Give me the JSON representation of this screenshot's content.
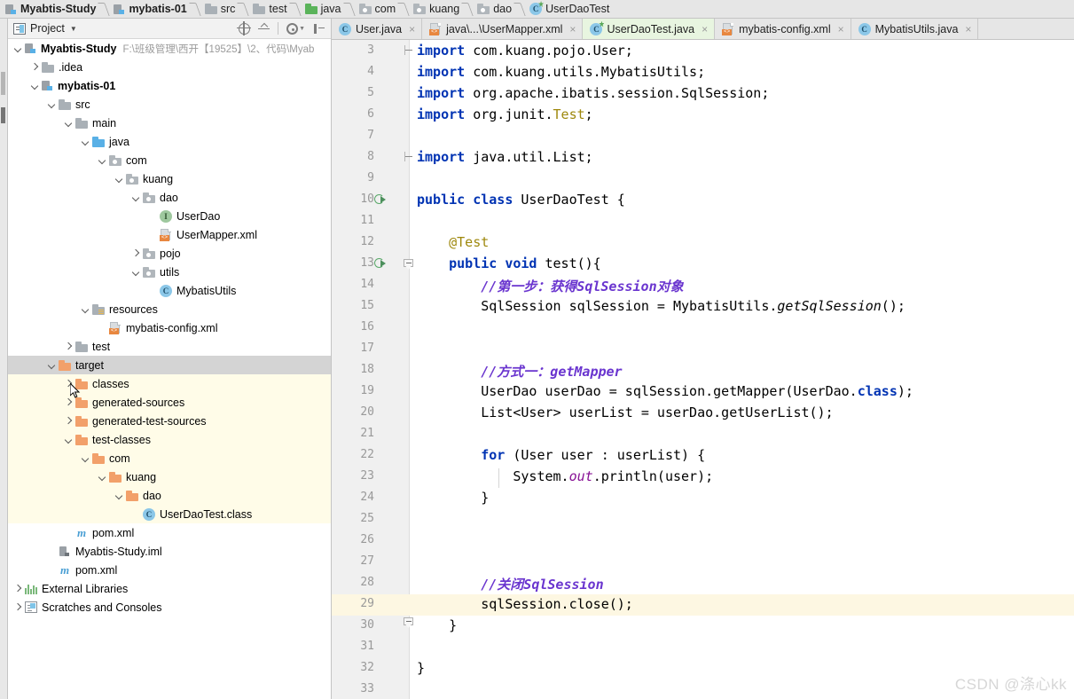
{
  "navbar": {
    "crumbs": [
      {
        "label": "Myabtis-Study",
        "icon": "module-icon",
        "bold": true
      },
      {
        "label": "mybatis-01",
        "icon": "module-icon",
        "bold": true
      },
      {
        "label": "src",
        "icon": "folder-gray-icon",
        "bold": false
      },
      {
        "label": "test",
        "icon": "folder-gray-icon",
        "bold": false
      },
      {
        "label": "java",
        "icon": "folder-green-icon",
        "bold": false
      },
      {
        "label": "com",
        "icon": "package-icon",
        "bold": false
      },
      {
        "label": "kuang",
        "icon": "package-icon",
        "bold": false
      },
      {
        "label": "dao",
        "icon": "package-icon",
        "bold": false
      },
      {
        "label": "UserDaoTest",
        "icon": "java-test-class-icon",
        "bold": false
      }
    ]
  },
  "project_panel": {
    "title": "Project",
    "toolbar_icons": [
      "locate-icon",
      "collapse-all-icon",
      "settings-gear-icon",
      "hide-panel-icon"
    ],
    "tree": [
      {
        "label": "Myabtis-Study",
        "path": "F:\\班级管理\\西开【19525】\\2、代码\\Myab",
        "icon": "module-icon",
        "arrow": "down",
        "depth": 0,
        "bold": true,
        "selected": false,
        "tinted": false
      },
      {
        "label": ".idea",
        "icon": "folder-gray-icon",
        "arrow": "right",
        "depth": 1,
        "bold": false,
        "selected": false,
        "tinted": false
      },
      {
        "label": "mybatis-01",
        "icon": "module-icon",
        "arrow": "down",
        "depth": 1,
        "bold": true,
        "selected": false,
        "tinted": false
      },
      {
        "label": "src",
        "icon": "folder-gray-icon",
        "arrow": "down",
        "depth": 2,
        "bold": false,
        "selected": false,
        "tinted": false
      },
      {
        "label": "main",
        "icon": "folder-gray-icon",
        "arrow": "down",
        "depth": 3,
        "bold": false,
        "selected": false,
        "tinted": false
      },
      {
        "label": "java",
        "icon": "folder-blue-icon",
        "arrow": "down",
        "depth": 4,
        "bold": false,
        "selected": false,
        "tinted": false
      },
      {
        "label": "com",
        "icon": "package-icon",
        "arrow": "down",
        "depth": 5,
        "bold": false,
        "selected": false,
        "tinted": false
      },
      {
        "label": "kuang",
        "icon": "package-icon",
        "arrow": "down",
        "depth": 6,
        "bold": false,
        "selected": false,
        "tinted": false
      },
      {
        "label": "dao",
        "icon": "package-icon",
        "arrow": "down",
        "depth": 7,
        "bold": false,
        "selected": false,
        "tinted": false
      },
      {
        "label": "UserDao",
        "icon": "java-interface-icon",
        "arrow": "none",
        "depth": 8,
        "bold": false,
        "selected": false,
        "tinted": false
      },
      {
        "label": "UserMapper.xml",
        "icon": "xml-file-icon",
        "arrow": "none",
        "depth": 8,
        "bold": false,
        "selected": false,
        "tinted": false
      },
      {
        "label": "pojo",
        "icon": "package-icon",
        "arrow": "right",
        "depth": 7,
        "bold": false,
        "selected": false,
        "tinted": false
      },
      {
        "label": "utils",
        "icon": "package-icon",
        "arrow": "down",
        "depth": 7,
        "bold": false,
        "selected": false,
        "tinted": false
      },
      {
        "label": "MybatisUtils",
        "icon": "java-class-icon",
        "arrow": "none",
        "depth": 8,
        "bold": false,
        "selected": false,
        "tinted": false
      },
      {
        "label": "resources",
        "icon": "resources-folder-icon",
        "arrow": "down",
        "depth": 4,
        "bold": false,
        "selected": false,
        "tinted": false
      },
      {
        "label": "mybatis-config.xml",
        "icon": "xml-file-icon",
        "arrow": "none",
        "depth": 5,
        "bold": false,
        "selected": false,
        "tinted": false
      },
      {
        "label": "test",
        "icon": "folder-gray-icon",
        "arrow": "right",
        "depth": 3,
        "bold": false,
        "selected": false,
        "tinted": false
      },
      {
        "label": "target",
        "icon": "folder-orange-icon",
        "arrow": "down",
        "depth": 2,
        "bold": false,
        "selected": true,
        "tinted": false
      },
      {
        "label": "classes",
        "icon": "folder-orange-icon",
        "arrow": "right",
        "depth": 3,
        "bold": false,
        "selected": false,
        "tinted": true
      },
      {
        "label": "generated-sources",
        "icon": "folder-orange-icon",
        "arrow": "right",
        "depth": 3,
        "bold": false,
        "selected": false,
        "tinted": true
      },
      {
        "label": "generated-test-sources",
        "icon": "folder-orange-icon",
        "arrow": "right",
        "depth": 3,
        "bold": false,
        "selected": false,
        "tinted": true
      },
      {
        "label": "test-classes",
        "icon": "folder-orange-icon",
        "arrow": "down",
        "depth": 3,
        "bold": false,
        "selected": false,
        "tinted": true
      },
      {
        "label": "com",
        "icon": "folder-orange-icon",
        "arrow": "down",
        "depth": 4,
        "bold": false,
        "selected": false,
        "tinted": true
      },
      {
        "label": "kuang",
        "icon": "folder-orange-icon",
        "arrow": "down",
        "depth": 5,
        "bold": false,
        "selected": false,
        "tinted": true
      },
      {
        "label": "dao",
        "icon": "folder-orange-icon",
        "arrow": "down",
        "depth": 6,
        "bold": false,
        "selected": false,
        "tinted": true
      },
      {
        "label": "UserDaoTest.class",
        "icon": "java-class-file-icon",
        "arrow": "none",
        "depth": 7,
        "bold": false,
        "selected": false,
        "tinted": true
      },
      {
        "label": "pom.xml",
        "icon": "maven-icon",
        "arrow": "none",
        "depth": 3,
        "bold": false,
        "selected": false,
        "tinted": false
      },
      {
        "label": "Myabtis-Study.iml",
        "icon": "iml-file-icon",
        "arrow": "none",
        "depth": 2,
        "bold": false,
        "selected": false,
        "tinted": false
      },
      {
        "label": "pom.xml",
        "icon": "maven-icon",
        "arrow": "none",
        "depth": 2,
        "bold": false,
        "selected": false,
        "tinted": false
      },
      {
        "label": "External Libraries",
        "icon": "library-icon",
        "arrow": "right",
        "depth": 0,
        "bold": false,
        "selected": false,
        "tinted": false
      },
      {
        "label": "Scratches and Consoles",
        "icon": "scratches-icon",
        "arrow": "right",
        "depth": 0,
        "bold": false,
        "selected": false,
        "tinted": false
      }
    ]
  },
  "editor_tabs": [
    {
      "label": "User.java",
      "icon": "java-class-icon",
      "active": false,
      "close": "×"
    },
    {
      "label": "java\\...\\UserMapper.xml",
      "icon": "xml-file-icon",
      "active": false,
      "close": "×"
    },
    {
      "label": "UserDaoTest.java",
      "icon": "java-test-class-icon",
      "active": true,
      "close": "×"
    },
    {
      "label": "mybatis-config.xml",
      "icon": "xml-file-icon",
      "active": false,
      "close": "×"
    },
    {
      "label": "MybatisUtils.java",
      "icon": "java-class-icon",
      "active": false,
      "close": "×"
    }
  ],
  "editor": {
    "first_line": 3,
    "highlighted_line": 29,
    "run_gutter_lines": [
      10,
      13
    ],
    "fold_lines": [
      3,
      8,
      13,
      30
    ],
    "lines": [
      {
        "n": 3,
        "tokens": [
          {
            "t": "import ",
            "c": "kw"
          },
          {
            "t": "com.kuang.pojo.User;",
            "c": "plain"
          }
        ]
      },
      {
        "n": 4,
        "tokens": [
          {
            "t": "import ",
            "c": "kw"
          },
          {
            "t": "com.kuang.utils.MybatisUtils;",
            "c": "plain"
          }
        ]
      },
      {
        "n": 5,
        "tokens": [
          {
            "t": "import ",
            "c": "kw"
          },
          {
            "t": "org.apache.ibatis.session.SqlSession;",
            "c": "plain"
          }
        ]
      },
      {
        "n": 6,
        "tokens": [
          {
            "t": "import ",
            "c": "kw"
          },
          {
            "t": "org.junit.",
            "c": "plain"
          },
          {
            "t": "Test",
            "c": "ann"
          },
          {
            "t": ";",
            "c": "plain"
          }
        ]
      },
      {
        "n": 7,
        "tokens": []
      },
      {
        "n": 8,
        "tokens": [
          {
            "t": "import ",
            "c": "kw"
          },
          {
            "t": "java.util.List;",
            "c": "plain"
          }
        ]
      },
      {
        "n": 9,
        "tokens": []
      },
      {
        "n": 10,
        "tokens": [
          {
            "t": "public class ",
            "c": "kw"
          },
          {
            "t": "UserDaoTest {",
            "c": "plain"
          }
        ]
      },
      {
        "n": 11,
        "tokens": []
      },
      {
        "n": 12,
        "tokens": [
          {
            "t": "    @Test",
            "c": "ann"
          }
        ]
      },
      {
        "n": 13,
        "tokens": [
          {
            "t": "    ",
            "c": "plain"
          },
          {
            "t": "public void ",
            "c": "kw"
          },
          {
            "t": "test(){",
            "c": "plain"
          }
        ]
      },
      {
        "n": 14,
        "tokens": [
          {
            "t": "        //第一步：获得SqlSession对象",
            "c": "cm"
          }
        ]
      },
      {
        "n": 15,
        "tokens": [
          {
            "t": "        SqlSession sqlSession = MybatisUtils.",
            "c": "plain"
          },
          {
            "t": "getSqlSession",
            "c": "methi"
          },
          {
            "t": "();",
            "c": "plain"
          }
        ]
      },
      {
        "n": 16,
        "tokens": []
      },
      {
        "n": 17,
        "tokens": []
      },
      {
        "n": 18,
        "tokens": [
          {
            "t": "        //方式一：getMapper",
            "c": "cm"
          }
        ]
      },
      {
        "n": 19,
        "tokens": [
          {
            "t": "        UserDao userDao = sqlSession.getMapper(UserDao.",
            "c": "plain"
          },
          {
            "t": "class",
            "c": "kw"
          },
          {
            "t": ");",
            "c": "plain"
          }
        ]
      },
      {
        "n": 20,
        "tokens": [
          {
            "t": "        List<User> userList = userDao.getUserList();",
            "c": "plain"
          }
        ]
      },
      {
        "n": 21,
        "tokens": []
      },
      {
        "n": 22,
        "tokens": [
          {
            "t": "        ",
            "c": "plain"
          },
          {
            "t": "for ",
            "c": "kw"
          },
          {
            "t": "(User user : userList) {",
            "c": "plain"
          }
        ]
      },
      {
        "n": 23,
        "tokens": [
          {
            "t": "            System.",
            "c": "plain"
          },
          {
            "t": "out",
            "c": "fieldi"
          },
          {
            "t": ".println(user);",
            "c": "plain"
          }
        ]
      },
      {
        "n": 24,
        "tokens": [
          {
            "t": "        }",
            "c": "plain"
          }
        ]
      },
      {
        "n": 25,
        "tokens": []
      },
      {
        "n": 26,
        "tokens": []
      },
      {
        "n": 27,
        "tokens": []
      },
      {
        "n": 28,
        "tokens": [
          {
            "t": "        //关闭SqlSession",
            "c": "cm"
          }
        ]
      },
      {
        "n": 29,
        "tokens": [
          {
            "t": "        sqlSession.close();",
            "c": "plain"
          }
        ]
      },
      {
        "n": 30,
        "tokens": [
          {
            "t": "    }",
            "c": "plain"
          }
        ]
      },
      {
        "n": 31,
        "tokens": []
      },
      {
        "n": 32,
        "tokens": [
          {
            "t": "}",
            "c": "plain"
          }
        ]
      },
      {
        "n": 33,
        "tokens": []
      }
    ]
  },
  "watermark": "CSDN @涤心kk",
  "colors": {
    "keyword": "#0033b3",
    "annotation": "#9e880d",
    "comment": "#6a35cf",
    "field_italic": "#871094",
    "active_tab_bg": "#e8f5e0",
    "highlight_line_bg": "#fdf7e2",
    "tinted_tree_bg": "#fffce8",
    "selection_bg": "#d4d4d4"
  }
}
